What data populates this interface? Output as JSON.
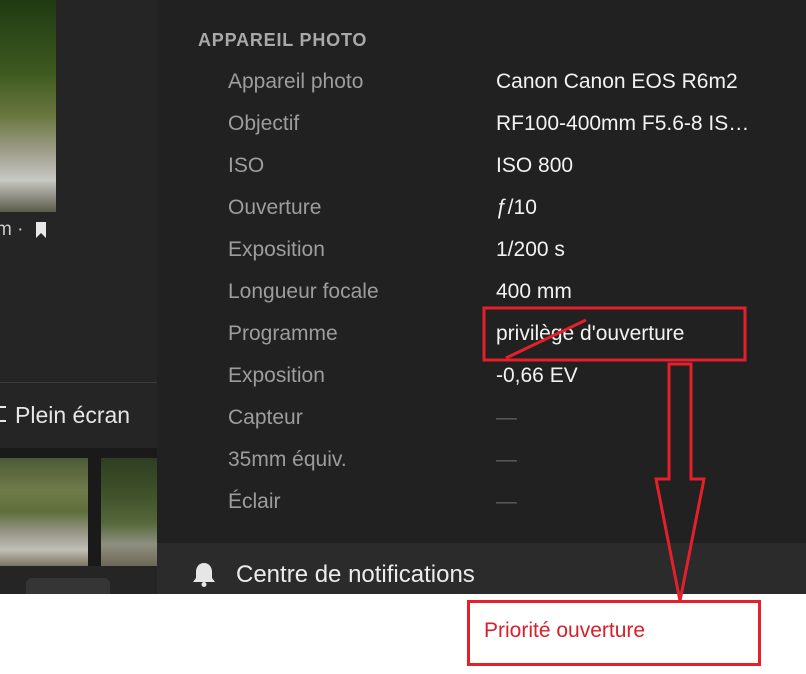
{
  "left": {
    "photo_meta": "m ·",
    "fullscreen_label": "Plein écran"
  },
  "panel": {
    "section_title": "APPAREIL PHOTO",
    "rows": [
      {
        "label": "Appareil photo",
        "value": "Canon Canon EOS R6m2"
      },
      {
        "label": "Objectif",
        "value": "RF100-400mm F5.6-8 IS…"
      },
      {
        "label": "ISO",
        "value": "ISO 800"
      },
      {
        "label": "Ouverture",
        "value": "ƒ/10"
      },
      {
        "label": "Exposition",
        "value": "1/200 s"
      },
      {
        "label": "Longueur focale",
        "value": "400 mm"
      },
      {
        "label": "Programme",
        "value": "privilège d'ouverture"
      },
      {
        "label": "Exposition",
        "value": "-0,66 EV"
      },
      {
        "label": "Capteur",
        "value": "—"
      },
      {
        "label": "35mm équiv.",
        "value": "—"
      },
      {
        "label": "Éclair",
        "value": "—"
      }
    ],
    "notifications_label": "Centre de notifications"
  },
  "annotation": {
    "note": "Priorité ouverture",
    "color": "#e4202a"
  },
  "colors": {
    "panel_bg": "#212121",
    "label": "#9d9d9d",
    "value": "#f2f2f2",
    "empty_value": "#5e5e5e"
  }
}
